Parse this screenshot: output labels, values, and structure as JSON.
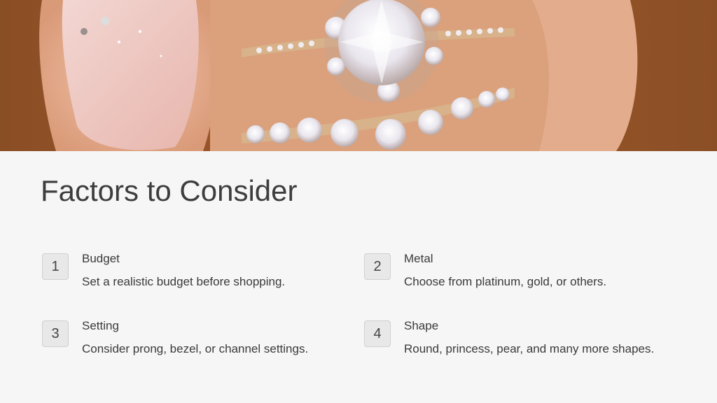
{
  "slide": {
    "title": "Factors to Consider",
    "hero_image": "rings-on-hand-photo",
    "colors": {
      "background": "#f6f6f6",
      "text": "#3a3a3a",
      "badge_bg": "#e8e8e8",
      "badge_border": "#cfcfcf"
    },
    "items": [
      {
        "number": "1",
        "title": "Budget",
        "description": "Set a realistic budget before shopping."
      },
      {
        "number": "2",
        "title": "Metal",
        "description": "Choose from platinum, gold, or others."
      },
      {
        "number": "3",
        "title": "Setting",
        "description": "Consider prong, bezel, or channel settings."
      },
      {
        "number": "4",
        "title": "Shape",
        "description": "Round, princess, pear, and many more shapes."
      }
    ]
  }
}
